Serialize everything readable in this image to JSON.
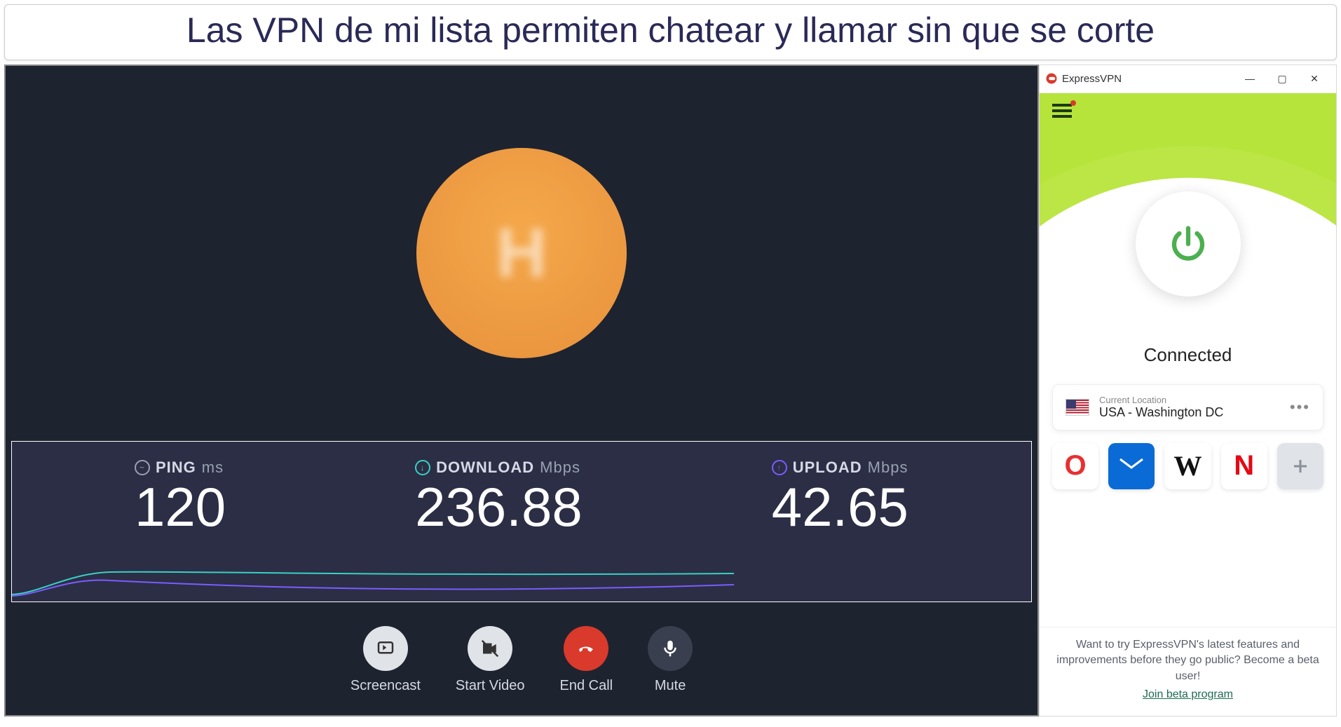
{
  "headline": "Las VPN de mi lista permiten chatear y llamar sin que se corte",
  "call": {
    "avatar_letter": "H",
    "controls": {
      "screencast": "Screencast",
      "start_video": "Start Video",
      "end_call": "End Call",
      "mute": "Mute"
    }
  },
  "speedtest": {
    "ping_label": "PING",
    "ping_unit": "ms",
    "ping_value": "120",
    "download_label": "DOWNLOAD",
    "download_unit": "Mbps",
    "download_value": "236.88",
    "upload_label": "UPLOAD",
    "upload_unit": "Mbps",
    "upload_value": "42.65"
  },
  "vpn": {
    "window_title": "ExpressVPN",
    "status": "Connected",
    "location_label": "Current Location",
    "location_name": "USA - Washington DC",
    "shortcuts": {
      "opera": "O",
      "wikipedia": "W",
      "netflix": "N",
      "add": "+"
    },
    "beta_text": "Want to try ExpressVPN's latest features and improvements before they go public? Become a beta user!",
    "beta_link": "Join beta program"
  }
}
